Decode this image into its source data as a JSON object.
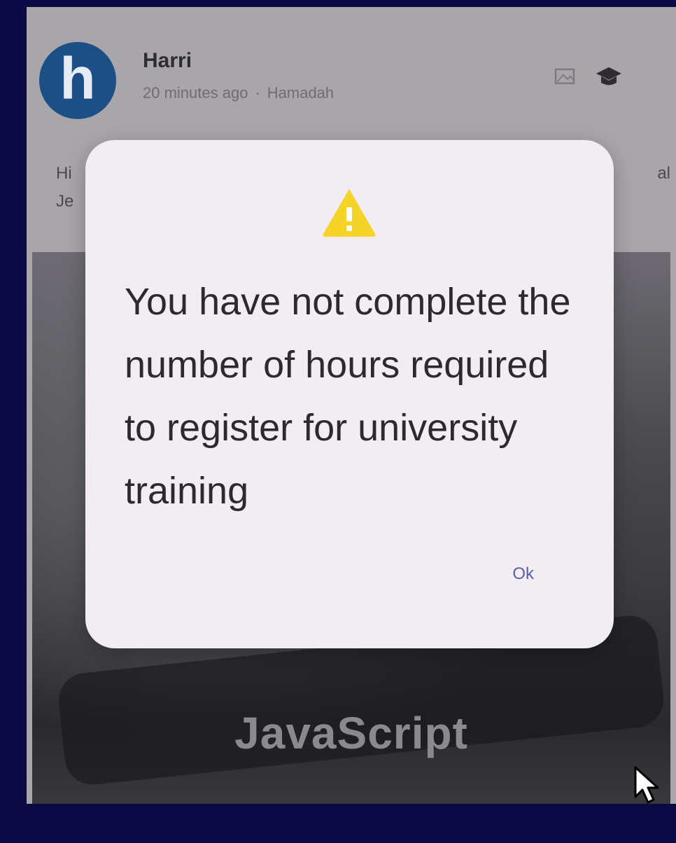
{
  "post": {
    "author": "Harri",
    "time": "20 minutes ago",
    "location": "Hamadah",
    "text_left": "Hi",
    "text_left_line2": "Je",
    "text_right": "al"
  },
  "media": {
    "title": "JavaScript"
  },
  "dialog": {
    "message": "You have not complete the number of hours required to register for university training",
    "ok_label": "Ok"
  },
  "icons": {
    "warning_color": "#f5d427",
    "avatar_color": "#1c4f86",
    "avatar_letter": "h"
  }
}
